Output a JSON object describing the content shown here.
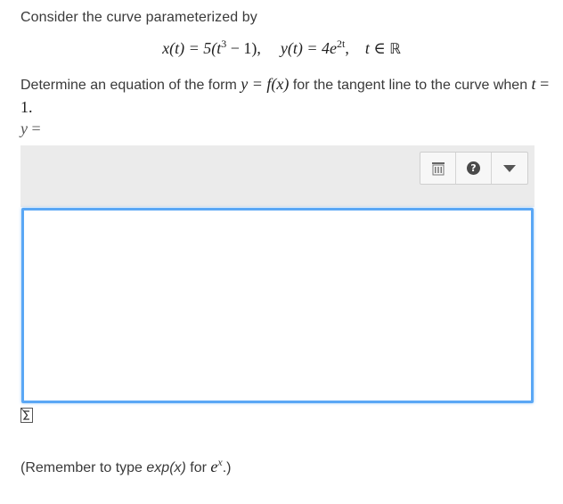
{
  "question": {
    "intro": "Consider the curve parameterized by",
    "equation": {
      "x_lhs": "x(t) = 5(t",
      "x_exp": "3",
      "x_rhs": " − 1),",
      "y_lhs": "y(t) = 4e",
      "y_exp": "2t",
      "y_rhs": ",",
      "domain_var": "t",
      "domain_in": " ∈ ",
      "domain_set": "ℝ"
    },
    "task_part1": "Determine an equation of the form ",
    "task_math": "y = f(x)",
    "task_part2": " for the tangent line to the curve when ",
    "task_t": "t",
    "task_eq": " = 1",
    "task_end": ".",
    "answer_label_var": "y",
    "answer_label_eq": " ="
  },
  "answer": {
    "value": ""
  },
  "toolbar": {
    "tools": [
      "keyboard-icon",
      "help-icon",
      "dropdown-arrow-icon"
    ],
    "help_glyph": "?"
  },
  "reminder": {
    "prefix": "(Remember to type ",
    "code": "exp(x)",
    "middle": " for ",
    "base": "e",
    "exp": "x",
    "suffix": ".)"
  }
}
